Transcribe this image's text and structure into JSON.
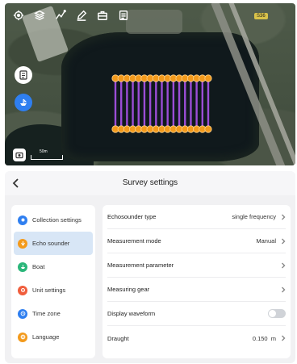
{
  "map": {
    "road_label": "S36",
    "scale_label": "50m",
    "toolbar_icons": [
      "locate-icon",
      "layers-icon",
      "track-icon",
      "edit-icon",
      "toolbox-icon",
      "survey-icon"
    ],
    "side_buttons": [
      "document-icon",
      "boat-icon"
    ],
    "survey": {
      "line_count": 17,
      "line_color": "#9b4dd6",
      "point_color": "#f39a1c"
    }
  },
  "settings": {
    "title": "Survey settings",
    "nav": [
      {
        "label": "Collection settings",
        "icon": "collection-icon",
        "color": "#2f7ff0",
        "active": false
      },
      {
        "label": "Echo sounder",
        "icon": "echo-sounder-icon",
        "color": "#f39a1c",
        "active": true
      },
      {
        "label": "Boat",
        "icon": "boat-icon",
        "color": "#2bb67a",
        "active": false
      },
      {
        "label": "Unit settings",
        "icon": "unit-icon",
        "color": "#f05d3c",
        "active": false
      },
      {
        "label": "Time zone",
        "icon": "clock-icon",
        "color": "#2f7ff0",
        "active": false
      },
      {
        "label": "Language",
        "icon": "globe-icon",
        "color": "#f39a1c",
        "active": false
      }
    ],
    "rows": [
      {
        "label": "Echosounder type",
        "value": "single frequency",
        "control": "chevron"
      },
      {
        "label": "Measurement mode",
        "value": "Manual",
        "control": "chevron"
      },
      {
        "label": "Measurement parameter",
        "value": "",
        "control": "chevron"
      },
      {
        "label": "Measuring gear",
        "value": "",
        "control": "chevron"
      },
      {
        "label": "Display waveform",
        "value": "",
        "control": "toggle",
        "toggle_on": false
      },
      {
        "label": "Draught",
        "value": "0.150  m",
        "control": "chevron"
      }
    ]
  }
}
